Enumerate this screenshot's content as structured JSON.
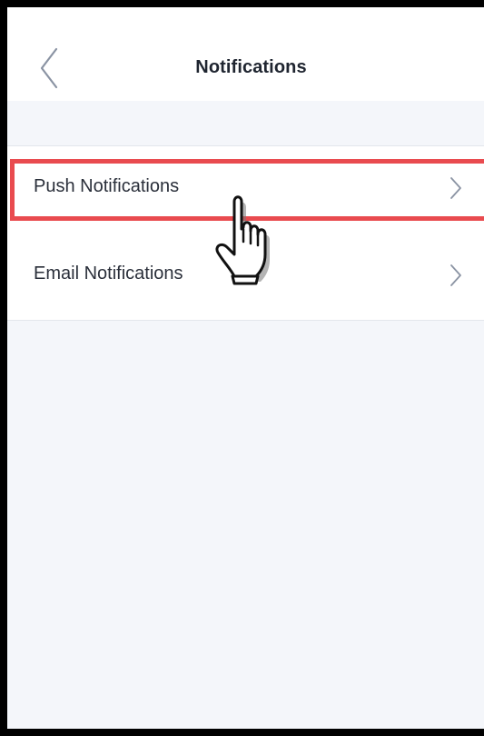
{
  "header": {
    "title": "Notifications",
    "back_icon": "chevron-left-icon"
  },
  "settings_list": {
    "items": [
      {
        "label": "Push Notifications",
        "icon": "chevron-right-icon",
        "highlighted": true
      },
      {
        "label": "Email Notifications",
        "icon": "chevron-right-icon",
        "highlighted": false
      }
    ]
  },
  "overlay": {
    "pointer_icon": "hand-pointer-icon",
    "highlight_color": "#e94b4f"
  },
  "colors": {
    "background": "#f4f6fa",
    "surface": "#ffffff",
    "text": "#2a2f3a",
    "chevron": "#8a93a3"
  }
}
